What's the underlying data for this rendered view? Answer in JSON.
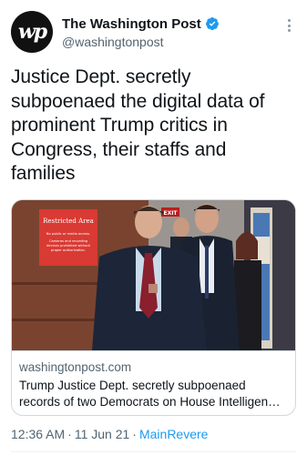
{
  "account": {
    "display_name": "The Washington Post",
    "handle": "@washingtonpost",
    "avatar_text": "wp",
    "verified": true
  },
  "tweet": {
    "text": "Justice Dept. secretly subpoenaed the digital data of prominent Trump critics in Congress, their staffs and families"
  },
  "card": {
    "image_sign": {
      "title": "Restricted Area",
      "line1": "No public or media access.",
      "line2": "Cameras and recording",
      "line3": "devices prohibited without",
      "line4": "proper authorization."
    },
    "exit_sign": "EXIT",
    "domain": "washingtonpost.com",
    "title": "Trump Justice Dept. secretly subpoenaed records of two Democrats on House Intelligen…"
  },
  "meta": {
    "time": "12:36 AM",
    "date": "11 Jun 21",
    "separator": "·",
    "source": "MainRevere"
  },
  "colors": {
    "accent": "#1d9bf0",
    "text_primary": "#0f1419",
    "text_secondary": "#536471",
    "sign_red": "#d93a33"
  }
}
